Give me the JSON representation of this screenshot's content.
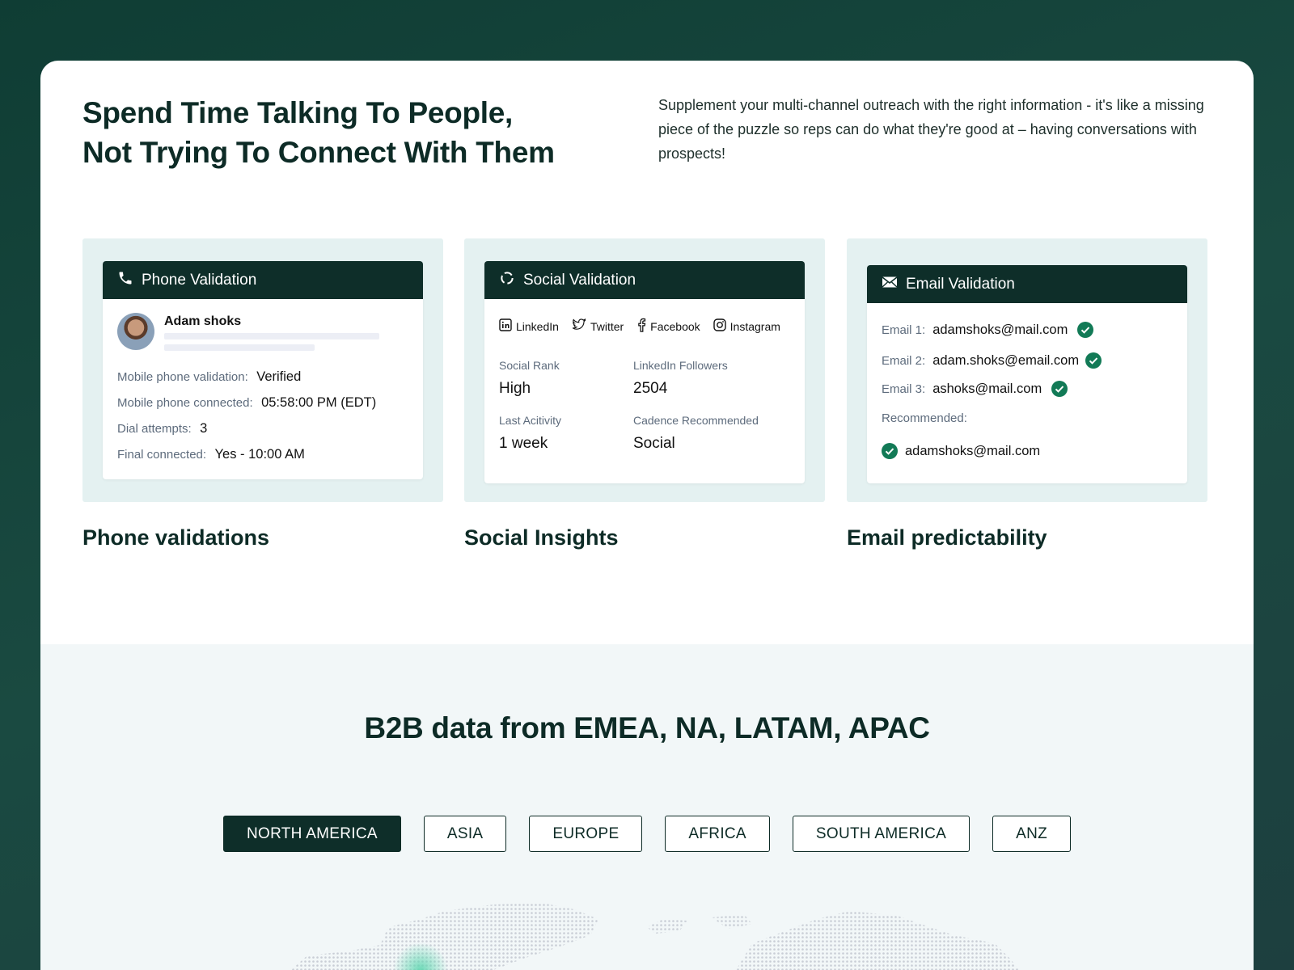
{
  "hero": {
    "title": "Spend Time Talking To People, Not Trying To Connect With Them",
    "description": "Supplement your multi-channel outreach with the right information - it's like a missing piece of the puzzle so reps can do what they're good at – having conversations with prospects!"
  },
  "phone": {
    "header": "Phone Validation",
    "name": "Adam shoks",
    "rows": [
      {
        "label": "Mobile phone validation:",
        "value": "Verified"
      },
      {
        "label": "Mobile phone connected:",
        "value": "05:58:00 PM (EDT)"
      },
      {
        "label": "Dial attempts:",
        "value": "3"
      },
      {
        "label": "Final connected:",
        "value": "Yes - 10:00 AM"
      }
    ],
    "caption": "Phone validations"
  },
  "social": {
    "header": "Social Validation",
    "networks": [
      "LinkedIn",
      "Twitter",
      "Facebook",
      "Instagram"
    ],
    "stats": [
      {
        "label": "Social Rank",
        "value": "High"
      },
      {
        "label": "LinkedIn Followers",
        "value": "2504"
      },
      {
        "label": "Last Acitivity",
        "value": "1 week"
      },
      {
        "label": "Cadence Recommended",
        "value": "Social"
      }
    ],
    "caption": "Social Insights"
  },
  "email": {
    "header": "Email Validation",
    "rows": [
      {
        "label": "Email 1:",
        "value": "adamshoks@mail.com"
      },
      {
        "label": "Email 2:",
        "value": "adam.shoks@email.com"
      },
      {
        "label": "Email 3:",
        "value": "ashoks@mail.com"
      }
    ],
    "recommended_label": "Recommended:",
    "recommended_value": "adamshoks@mail.com",
    "caption": "Email predictability"
  },
  "regions": {
    "title": "B2B data from EMEA, NA, LATAM, APAC",
    "tabs": [
      "NORTH AMERICA",
      "ASIA",
      "EUROPE",
      "AFRICA",
      "SOUTH AMERICA",
      "ANZ"
    ],
    "active": "NORTH AMERICA"
  },
  "colors": {
    "dark": "#0e2e29",
    "panel": "#e4f1f1",
    "check": "#127a56"
  }
}
